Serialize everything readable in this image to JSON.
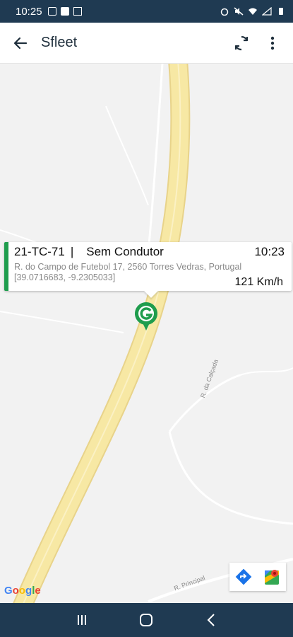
{
  "status_bar": {
    "time": "10:25",
    "left_icons": [
      "image-icon",
      "message-icon",
      "f-box-icon"
    ],
    "right_icons": [
      "alarm-icon",
      "mute-icon",
      "wifi-icon",
      "signal-icon",
      "battery-icon"
    ]
  },
  "app_bar": {
    "title": "Sfleet",
    "back_icon": "back-arrow-icon",
    "actions": [
      "refresh-icon",
      "more-vert-icon"
    ]
  },
  "info_card": {
    "plate": "21-TC-71",
    "separator": "|",
    "driver": "Sem Condutor",
    "time": "10:23",
    "address": "R. do Campo de Futebol 17, 2560 Torres Vedras, Portugal",
    "coords": "[39.0716683, -9.2305033]",
    "speed": "121 Km/h",
    "accent_color": "#1f9d4d"
  },
  "map": {
    "road_labels": [
      "R. da Calçada",
      "R. Principal"
    ],
    "logo": "Google",
    "buttons": [
      "directions-icon",
      "google-maps-icon"
    ]
  },
  "nav_bar": {
    "buttons": [
      "recent-apps-icon",
      "home-icon",
      "back-nav-icon"
    ]
  },
  "colors": {
    "status_bar": "#1f3a52",
    "highway": "#f7e8a4",
    "map_bg": "#f2f2f2"
  }
}
